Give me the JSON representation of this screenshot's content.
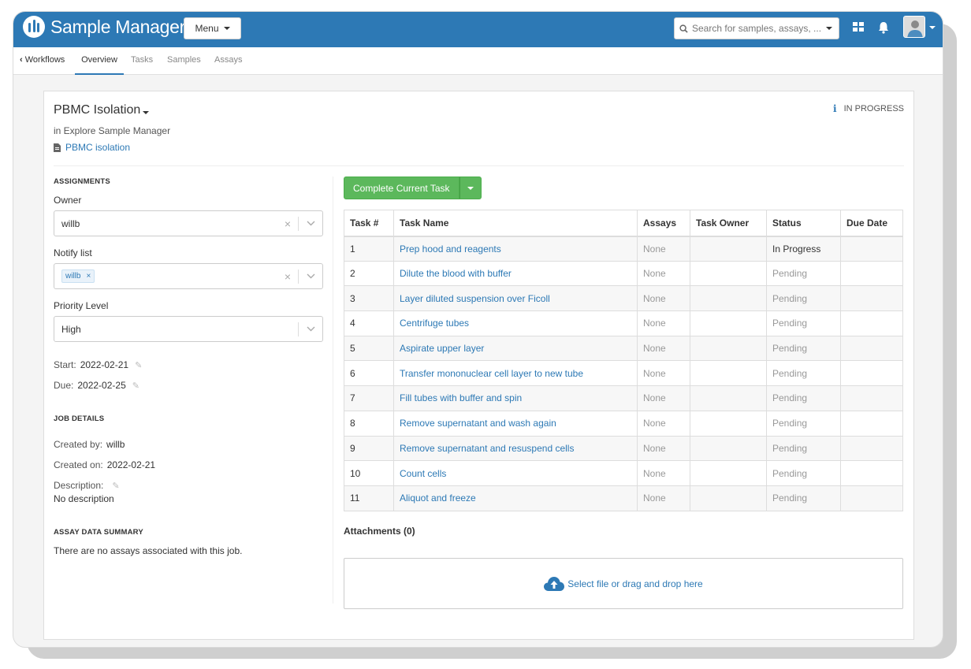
{
  "app": {
    "title": "Sample Manager"
  },
  "header": {
    "menu_label": "Menu",
    "search_placeholder": "Search for samples, assays, ...",
    "icons": [
      "search-icon",
      "grid-icon",
      "bell-icon",
      "avatar",
      "chevron-down-icon"
    ]
  },
  "nav": {
    "back_label": "Workflows",
    "tabs": [
      "Overview",
      "Tasks",
      "Samples",
      "Assays"
    ],
    "active_tab": "Overview"
  },
  "job": {
    "title": "PBMC Isolation",
    "project": "in Explore Sample Manager",
    "template_link": "PBMC isolation",
    "status": "IN PROGRESS"
  },
  "assignments": {
    "heading": "ASSIGNMENTS",
    "owner_label": "Owner",
    "owner_value": "willb",
    "notify_label": "Notify list",
    "notify_chip": "willb",
    "priority_label": "Priority Level",
    "priority_value": "High",
    "start_label": "Start:",
    "start_value": "2022-02-21",
    "due_label": "Due:",
    "due_value": "2022-02-25"
  },
  "job_details": {
    "heading": "JOB DETAILS",
    "created_by_label": "Created by:",
    "created_by_value": "willb",
    "created_on_label": "Created on:",
    "created_on_value": "2022-02-21",
    "description_label": "Description:",
    "description_value": "No description"
  },
  "assay_summary": {
    "heading": "ASSAY DATA SUMMARY",
    "text": "There are no assays associated with this job."
  },
  "actions": {
    "complete_label": "Complete Current Task"
  },
  "tasks": {
    "columns": [
      "Task #",
      "Task Name",
      "Assays",
      "Task Owner",
      "Status",
      "Due Date"
    ],
    "rows": [
      {
        "num": "1",
        "name": "Prep hood and reagents",
        "assays": "None",
        "owner": "",
        "status": "In Progress",
        "due": ""
      },
      {
        "num": "2",
        "name": "Dilute the blood with buffer",
        "assays": "None",
        "owner": "",
        "status": "Pending",
        "due": ""
      },
      {
        "num": "3",
        "name": "Layer diluted suspension over Ficoll",
        "assays": "None",
        "owner": "",
        "status": "Pending",
        "due": ""
      },
      {
        "num": "4",
        "name": "Centrifuge tubes",
        "assays": "None",
        "owner": "",
        "status": "Pending",
        "due": ""
      },
      {
        "num": "5",
        "name": "Aspirate upper layer",
        "assays": "None",
        "owner": "",
        "status": "Pending",
        "due": ""
      },
      {
        "num": "6",
        "name": "Transfer mononuclear cell layer to new tube",
        "assays": "None",
        "owner": "",
        "status": "Pending",
        "due": ""
      },
      {
        "num": "7",
        "name": "Fill tubes with buffer and spin",
        "assays": "None",
        "owner": "",
        "status": "Pending",
        "due": ""
      },
      {
        "num": "8",
        "name": "Remove supernatant and wash again",
        "assays": "None",
        "owner": "",
        "status": "Pending",
        "due": ""
      },
      {
        "num": "9",
        "name": "Remove supernatant and resuspend cells",
        "assays": "None",
        "owner": "",
        "status": "Pending",
        "due": ""
      },
      {
        "num": "10",
        "name": "Count cells",
        "assays": "None",
        "owner": "",
        "status": "Pending",
        "due": ""
      },
      {
        "num": "11",
        "name": "Aliquot and freeze",
        "assays": "None",
        "owner": "",
        "status": "Pending",
        "due": ""
      }
    ]
  },
  "attachments": {
    "title": "Attachments (0)",
    "drop_text": "Select file or drag and drop here"
  },
  "colors": {
    "brand": "#2d79b5",
    "success": "#5cb85c"
  }
}
